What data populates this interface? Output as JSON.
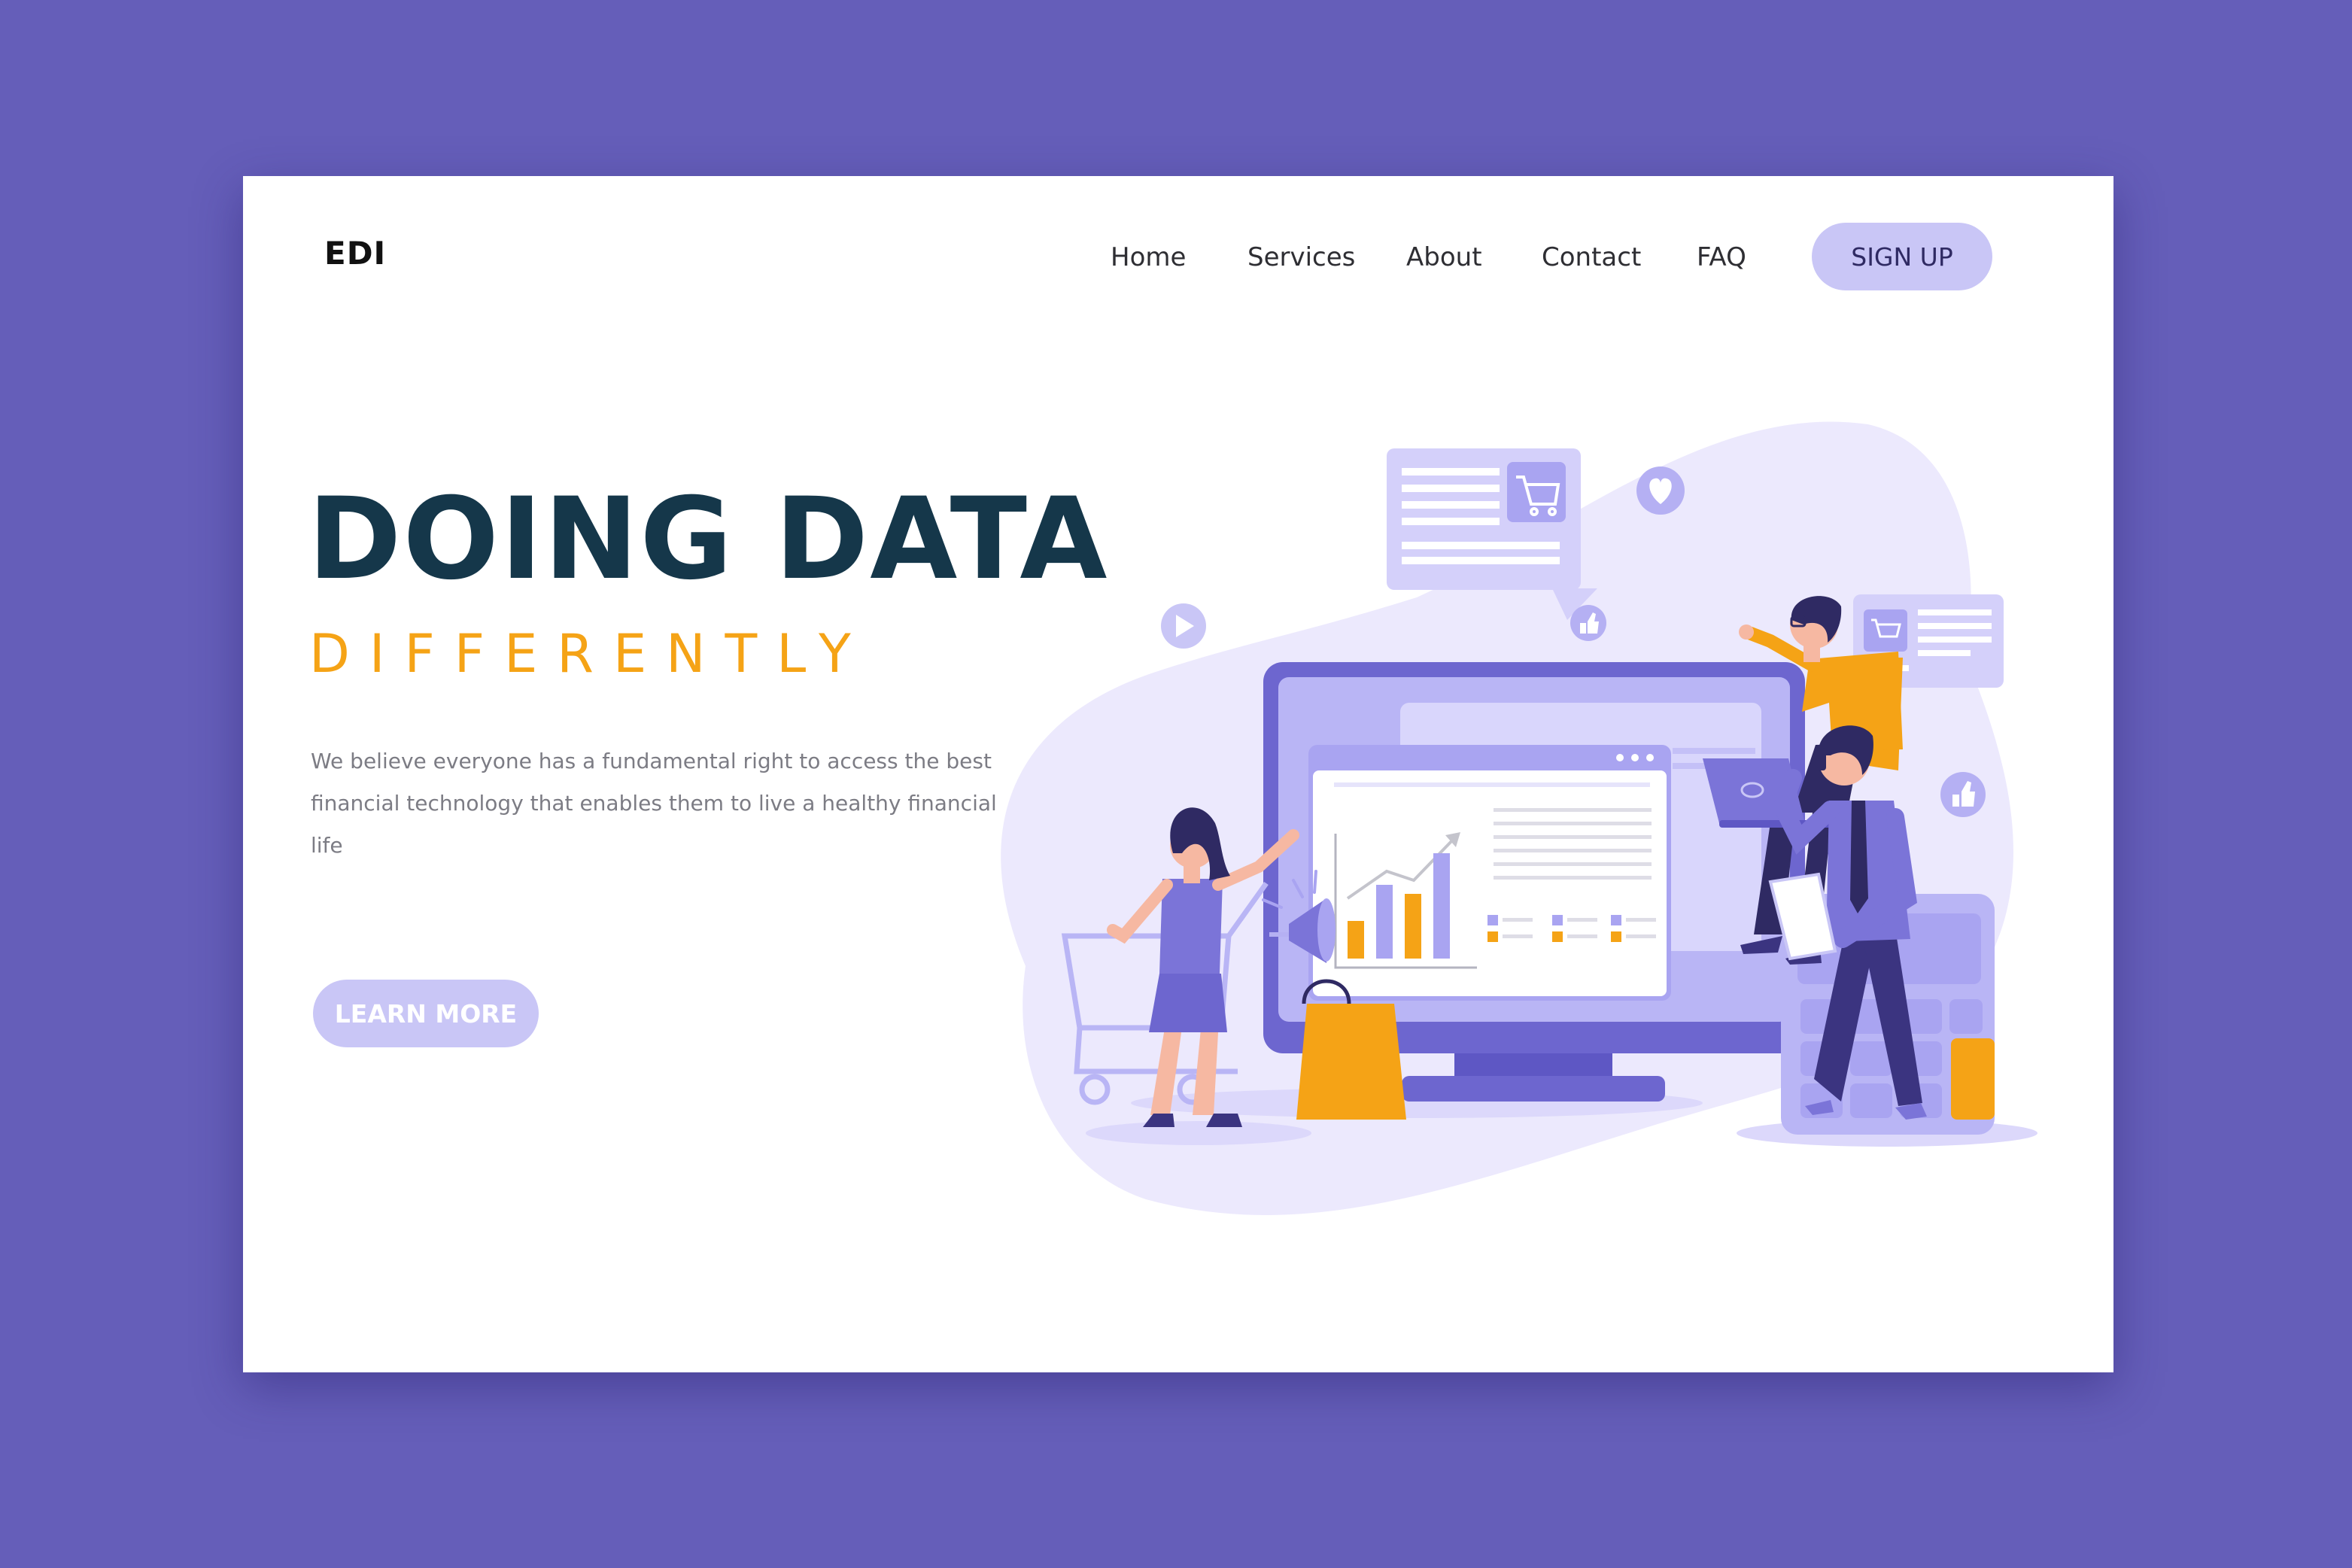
{
  "brand": {
    "logo": "EDI"
  },
  "nav": {
    "items": [
      {
        "label": "Home"
      },
      {
        "label": "Services"
      },
      {
        "label": "About"
      },
      {
        "label": "Contact"
      },
      {
        "label": "FAQ"
      }
    ],
    "signup_label": "SIGN UP"
  },
  "hero": {
    "title": "DOING DATA",
    "subtitle": "DIFFERENTLY",
    "description_line1": "We believe everyone has a fundamental right to access the best",
    "description_line2": "financial technology that enables them to live a healthy financial life",
    "cta_label": "LEARN MORE"
  },
  "colors": {
    "background": "#655eb9",
    "card": "#ffffff",
    "title": "#15374a",
    "accent_orange": "#f5a316",
    "pill_lavender": "#c9c6f6",
    "illustration_purple": "#7b74d8",
    "illustration_light": "#ece9fd"
  },
  "icons": [
    "play-icon",
    "heart-icon",
    "thumbs-up-icon",
    "cart-icon",
    "megaphone-icon",
    "laptop-icon"
  ]
}
